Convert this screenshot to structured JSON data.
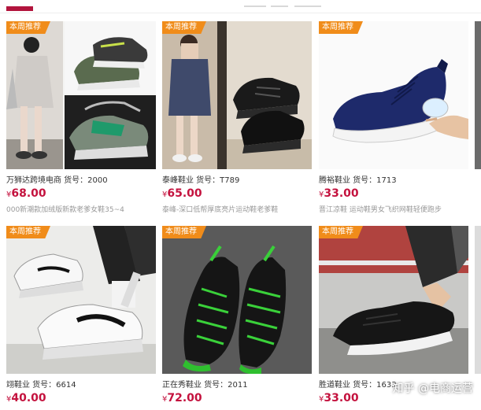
{
  "page": {
    "watermark": "知乎 @电商运营"
  },
  "colors": {
    "accent_top": "#b2153d",
    "ribbon": "#f08c1a",
    "price": "#c4123e"
  },
  "products": [
    {
      "badge": "本周推荐",
      "title": "万狮达跨境电商  货号：2000",
      "currency": "¥",
      "price": "68.00",
      "desc": "000新潮款加绒版新款老爹女鞋35~4",
      "image": "woman-and-green-chunky-sneakers"
    },
    {
      "badge": "本周推荐",
      "title": "泰峰鞋业  货号：T789",
      "currency": "¥",
      "price": "65.00",
      "desc": "泰峰-深口低帮厚底亮片运动鞋老爹鞋",
      "image": "girl-and-black-chunky-sneakers"
    },
    {
      "badge": "本周推荐",
      "title": "腾裕鞋业  货号：1713",
      "currency": "¥",
      "price": "33.00",
      "desc": "晋江凉鞋  运动鞋男女飞织网鞋轻便跑步",
      "image": "blue-knit-running-shoe"
    },
    {
      "badge": "本周推荐",
      "title": "翊鞋业  货号：6614",
      "currency": "¥",
      "price": "40.00",
      "desc": "",
      "image": "white-low-top-sneakers"
    },
    {
      "badge": "本周推荐",
      "title": "正在秀鞋业  货号：2011",
      "currency": "¥",
      "price": "72.00",
      "desc": "",
      "image": "black-green-knit-sneakers"
    },
    {
      "badge": "本周推荐",
      "title": "胜道鞋业  货号：1633",
      "currency": "¥",
      "price": "33.00",
      "desc": "",
      "image": "black-slip-on-sneakers"
    }
  ]
}
